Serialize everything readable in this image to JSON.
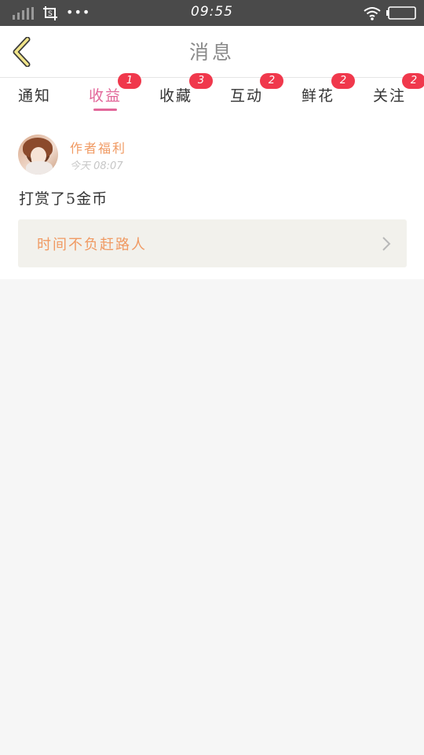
{
  "status_bar": {
    "time": "09:55",
    "dots": "•••"
  },
  "header": {
    "title": "消息"
  },
  "tabs": [
    {
      "label": "通知",
      "badge": ""
    },
    {
      "label": "收益",
      "badge": "1"
    },
    {
      "label": "收藏",
      "badge": "3"
    },
    {
      "label": "互动",
      "badge": "2"
    },
    {
      "label": "鲜花",
      "badge": "2"
    },
    {
      "label": "关注",
      "badge": "2"
    }
  ],
  "active_tab": "收益",
  "message": {
    "author": "作者福利",
    "timestamp": "今天 08:07",
    "text": "打赏了5金币",
    "book_title": "时间不负赶路人"
  },
  "colors": {
    "accent": "#e2679a",
    "badge": "#f0384c",
    "author": "#f09a63",
    "back_arrow": "#f1e58a"
  }
}
